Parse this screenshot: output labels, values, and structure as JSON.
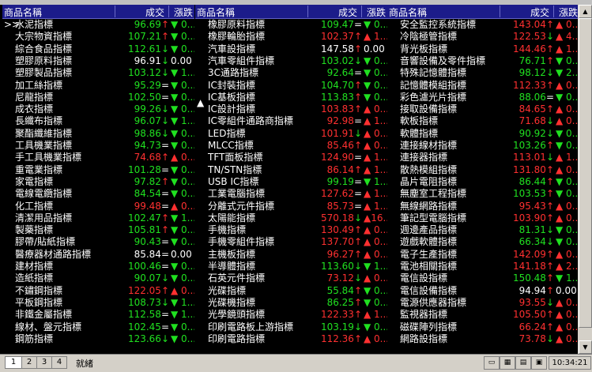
{
  "headers": {
    "name": "商品名稱",
    "price": "成交",
    "change": "漲跌"
  },
  "selected_marker": ">>",
  "columns": [
    [
      {
        "name": "水泥指標",
        "price": "96.69",
        "arrow": "↑",
        "dir": "dn",
        "chg": "▼ 0..."
      },
      {
        "name": "大宗物資指標",
        "price": "107.21",
        "arrow": "↑",
        "dir": "dn",
        "chg": "▼ 0..."
      },
      {
        "name": "綜合食品指標",
        "price": "112.61",
        "arrow": "↓",
        "dir": "dn",
        "chg": "▼ 0..."
      },
      {
        "name": "塑膠原料指標",
        "price": "96.91",
        "arrow": "↓",
        "dir": "fl",
        "chg": "0.00"
      },
      {
        "name": "塑膠製品指標",
        "price": "103.12",
        "arrow": "↓",
        "dir": "dn",
        "chg": "▼ 1..."
      },
      {
        "name": "加工絲指標",
        "price": "95.29",
        "arrow": "=",
        "dir": "dn",
        "chg": "▼ 0..."
      },
      {
        "name": "尼龍指標",
        "price": "102.50",
        "arrow": "=",
        "dir": "dn",
        "chg": "▼ 0..."
      },
      {
        "name": "成衣指標",
        "price": "99.26",
        "arrow": "↓",
        "dir": "dn",
        "chg": "▼ 0..."
      },
      {
        "name": "長纖布指標",
        "price": "96.07",
        "arrow": "↓",
        "dir": "dn",
        "chg": "▼ 1..."
      },
      {
        "name": "聚酯纖維指標",
        "price": "98.86",
        "arrow": "↓",
        "dir": "dn",
        "chg": "▼ 0..."
      },
      {
        "name": "工具機業指標",
        "price": "94.73",
        "arrow": "=",
        "dir": "dn",
        "chg": "▼ 0..."
      },
      {
        "name": "手工具機業指標",
        "price": "74.68",
        "arrow": "↑",
        "dir": "up",
        "chg": "▲ 0..."
      },
      {
        "name": "重電業指標",
        "price": "101.28",
        "arrow": "=",
        "dir": "dn",
        "chg": "▼ 0..."
      },
      {
        "name": "家電指標",
        "price": "97.82",
        "arrow": "↑",
        "dir": "dn",
        "chg": "▼ 0..."
      },
      {
        "name": "電線電纜指標",
        "price": "84.54",
        "arrow": "=",
        "dir": "dn",
        "chg": "▼ 0..."
      },
      {
        "name": "化工指標",
        "price": "99.48",
        "arrow": "=",
        "dir": "up",
        "chg": "▲ 0..."
      },
      {
        "name": "清潔用品指標",
        "price": "102.47",
        "arrow": "↑",
        "dir": "dn",
        "chg": "▼ 1..."
      },
      {
        "name": "製藥指標",
        "price": "105.81",
        "arrow": "↑",
        "dir": "dn",
        "chg": "▼ 0..."
      },
      {
        "name": "膠帶/貼紙指標",
        "price": "90.43",
        "arrow": "=",
        "dir": "dn",
        "chg": "▼ 0..."
      },
      {
        "name": "醫療器材通路指標",
        "price": "85.84",
        "arrow": "=",
        "dir": "fl",
        "chg": "0.00"
      },
      {
        "name": "建材指標",
        "price": "100.46",
        "arrow": "=",
        "dir": "dn",
        "chg": "▼ 0..."
      },
      {
        "name": "造紙指標",
        "price": "90.07",
        "arrow": "↓",
        "dir": "dn",
        "chg": "▼ 0..."
      },
      {
        "name": "不鏽鋼指標",
        "price": "122.05",
        "arrow": "↑",
        "dir": "up",
        "chg": "▲ 0..."
      },
      {
        "name": "平板鋼指標",
        "price": "108.73",
        "arrow": "↓",
        "dir": "dn",
        "chg": "▼ 1..."
      },
      {
        "name": "非鐵金屬指標",
        "price": "112.58",
        "arrow": "=",
        "dir": "dn",
        "chg": "▼ 1..."
      },
      {
        "name": "線材、盤元指標",
        "price": "102.45",
        "arrow": "=",
        "dir": "dn",
        "chg": "▼ 0..."
      },
      {
        "name": "鋼筋指標",
        "price": "123.66",
        "arrow": "↓",
        "dir": "dn",
        "chg": "▼ 0..."
      }
    ],
    [
      {
        "name": "橡膠原料指標",
        "price": "109.47",
        "arrow": "=",
        "dir": "dn",
        "chg": "▼ 0..."
      },
      {
        "name": "橡膠輪胎指標",
        "price": "102.37",
        "arrow": "↑",
        "dir": "up",
        "chg": "▲ 1..."
      },
      {
        "name": "汽車設指標",
        "price": "147.58",
        "arrow": "↑",
        "dir": "fl",
        "chg": "0.00"
      },
      {
        "name": "汽車零組件指標",
        "price": "103.02",
        "arrow": "↓",
        "dir": "dn",
        "chg": "▼ 0..."
      },
      {
        "name": "3C通路指標",
        "price": "92.64",
        "arrow": "=",
        "dir": "dn",
        "chg": "▼ 0..."
      },
      {
        "name": "IC封裝指標",
        "price": "104.70",
        "arrow": "↑",
        "dir": "dn",
        "chg": "▼ 0..."
      },
      {
        "name": "IC基板指標",
        "price": "113.83",
        "arrow": "↑",
        "dir": "dn",
        "chg": "▼ 0..."
      },
      {
        "name": "IC設計指標",
        "price": "103.83",
        "arrow": "↑",
        "dir": "up",
        "chg": "▲ 0..."
      },
      {
        "name": "IC零組件通路商指標",
        "price": "92.98",
        "arrow": "=",
        "dir": "up",
        "chg": "▲ 1..."
      },
      {
        "name": "LED指標",
        "price": "101.91",
        "arrow": "↓",
        "dir": "up",
        "chg": "▲ 0..."
      },
      {
        "name": "MLCC指標",
        "price": "85.46",
        "arrow": "↑",
        "dir": "up",
        "chg": "▲ 0..."
      },
      {
        "name": "TFT面板指標",
        "price": "124.90",
        "arrow": "=",
        "dir": "up",
        "chg": "▲ 1..."
      },
      {
        "name": "TN/STN指標",
        "price": "86.14",
        "arrow": "↑",
        "dir": "up",
        "chg": "▲ 1..."
      },
      {
        "name": "USB IC指標",
        "price": "99.19",
        "arrow": "=",
        "dir": "dn",
        "chg": "▼ 1..."
      },
      {
        "name": "工業電腦指標",
        "price": "127.62",
        "arrow": "=",
        "dir": "up",
        "chg": "▲ 1..."
      },
      {
        "name": "分離式元件指標",
        "price": "85.73",
        "arrow": "=",
        "dir": "up",
        "chg": "▲ 1..."
      },
      {
        "name": "太陽能指標",
        "price": "570.18",
        "arrow": "↓",
        "dir": "up",
        "chg": "▲16..."
      },
      {
        "name": "手機指標",
        "price": "130.49",
        "arrow": "↑",
        "dir": "up",
        "chg": "▲ 0..."
      },
      {
        "name": "手機零組件指標",
        "price": "137.70",
        "arrow": "↑",
        "dir": "up",
        "chg": "▲ 0..."
      },
      {
        "name": "主機板指標",
        "price": "96.27",
        "arrow": "↑",
        "dir": "up",
        "chg": "▲ 0..."
      },
      {
        "name": "半導體指標",
        "price": "113.60",
        "arrow": "↓",
        "dir": "dn",
        "chg": "▼ 1..."
      },
      {
        "name": "石英元件指標",
        "price": "73.12",
        "arrow": "↓",
        "dir": "up",
        "chg": "▲ 0..."
      },
      {
        "name": "光碟指標",
        "price": "55.84",
        "arrow": "↑",
        "dir": "dn",
        "chg": "▼ 0..."
      },
      {
        "name": "光碟機指標",
        "price": "86.25",
        "arrow": "↑",
        "dir": "dn",
        "chg": "▼ 0..."
      },
      {
        "name": "光學鏡頭指標",
        "price": "122.33",
        "arrow": "↑",
        "dir": "up",
        "chg": "▲ 1..."
      },
      {
        "name": "印刷電路板上游指標",
        "price": "103.19",
        "arrow": "↓",
        "dir": "dn",
        "chg": "▼ 0..."
      },
      {
        "name": "印刷電路指標",
        "price": "112.36",
        "arrow": "↑",
        "dir": "up",
        "chg": "▲ 0..."
      }
    ],
    [
      {
        "name": "安全監控系統指標",
        "price": "143.04",
        "arrow": "↑",
        "dir": "up",
        "chg": "▲ 0..."
      },
      {
        "name": "冷陰極管指標",
        "price": "122.53",
        "arrow": "↓",
        "dir": "up",
        "chg": "▲ 4..."
      },
      {
        "name": "背光板指標",
        "price": "144.46",
        "arrow": "↑",
        "dir": "up",
        "chg": "▲ 1..."
      },
      {
        "name": "音響設備及零件指標",
        "price": "76.71",
        "arrow": "↑",
        "dir": "dn",
        "chg": "▼ 0..."
      },
      {
        "name": "特殊記憶體指標",
        "price": "98.12",
        "arrow": "↓",
        "dir": "dn",
        "chg": "▼ 2..."
      },
      {
        "name": "記憶體模組指標",
        "price": "112.33",
        "arrow": "↑",
        "dir": "up",
        "chg": "▲ 0..."
      },
      {
        "name": "彩色濾光片指標",
        "price": "88.06",
        "arrow": "=",
        "dir": "dn",
        "chg": "▼ 0..."
      },
      {
        "name": "接取設備指標",
        "price": "84.65",
        "arrow": "↑",
        "dir": "up",
        "chg": "▲ 0..."
      },
      {
        "name": "軟板指標",
        "price": "71.68",
        "arrow": "↓",
        "dir": "up",
        "chg": "▲ 0..."
      },
      {
        "name": "軟體指標",
        "price": "90.92",
        "arrow": "↓",
        "dir": "dn",
        "chg": "▼ 0..."
      },
      {
        "name": "連接線材指標",
        "price": "103.26",
        "arrow": "↑",
        "dir": "dn",
        "chg": "▼ 0..."
      },
      {
        "name": "連接器指標",
        "price": "113.01",
        "arrow": "↓",
        "dir": "up",
        "chg": "▲ 1..."
      },
      {
        "name": "散熱模組指標",
        "price": "131.80",
        "arrow": "↑",
        "dir": "up",
        "chg": "▲ 0..."
      },
      {
        "name": "晶片電阻指標",
        "price": "86.44",
        "arrow": "↑",
        "dir": "dn",
        "chg": "▼ 0..."
      },
      {
        "name": "無塵室工程指標",
        "price": "103.53",
        "arrow": "↑",
        "dir": "dn",
        "chg": "▼ 0..."
      },
      {
        "name": "無線網路指標",
        "price": "95.43",
        "arrow": "↑",
        "dir": "up",
        "chg": "▲ 0..."
      },
      {
        "name": "筆記型電腦指標",
        "price": "103.90",
        "arrow": "↑",
        "dir": "up",
        "chg": "▲ 0..."
      },
      {
        "name": "週邊產品指標",
        "price": "81.31",
        "arrow": "↓",
        "dir": "dn",
        "chg": "▼ 0..."
      },
      {
        "name": "遊戲軟體指標",
        "price": "66.34",
        "arrow": "↓",
        "dir": "dn",
        "chg": "▼ 0..."
      },
      {
        "name": "電子生產指標",
        "price": "142.09",
        "arrow": "↑",
        "dir": "up",
        "chg": "▲ 0..."
      },
      {
        "name": "電池相關指標",
        "price": "141.18",
        "arrow": "↑",
        "dir": "up",
        "chg": "▲ 2..."
      },
      {
        "name": "電信設指標",
        "price": "150.48",
        "arrow": "↑",
        "dir": "dn",
        "chg": "▼ 1..."
      },
      {
        "name": "電信設備指標",
        "price": "94.94",
        "arrow": "↑",
        "dir": "fl",
        "chg": "0.00"
      },
      {
        "name": "電源供應器指標",
        "price": "93.55",
        "arrow": "↓",
        "dir": "up",
        "chg": "▲ 0..."
      },
      {
        "name": "監視器指標",
        "price": "105.50",
        "arrow": "↑",
        "dir": "up",
        "chg": "▲ 0..."
      },
      {
        "name": "磁碟陣列指標",
        "price": "66.24",
        "arrow": "↑",
        "dir": "up",
        "chg": "▲ 0..."
      },
      {
        "name": "網路設指標",
        "price": "73.78",
        "arrow": "↓",
        "dir": "up",
        "chg": "▲ 0..."
      }
    ]
  ],
  "tabs": [
    "1",
    "2",
    "3",
    "4"
  ],
  "status": "就緒",
  "clock": "10:34:21",
  "toolbar_icons": [
    "window-icon",
    "layout-icon",
    "chart-icon",
    "monitor-icon"
  ],
  "colors": {
    "up": "#ff3030",
    "down": "#20e020",
    "flat": "#ffffff",
    "header_bg": "#1c1c8a"
  }
}
